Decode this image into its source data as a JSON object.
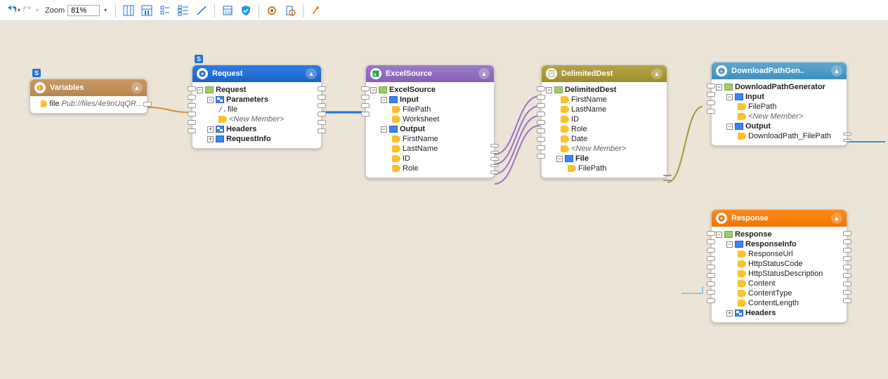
{
  "toolbar": {
    "zoom_label": "Zoom",
    "zoom_value": "81%"
  },
  "nodes": {
    "variables": {
      "title": "Variables",
      "file_label": "file",
      "file_value": "Pub://files/4e9nUqQR..."
    },
    "request": {
      "title": "Request",
      "root": "Request",
      "params": "Parameters",
      "file": "file",
      "newmember": "<New Member>",
      "headers": "Headers",
      "reqinfo": "RequestInfo"
    },
    "excel": {
      "title": "ExcelSource",
      "root": "ExcelSource",
      "input": "Input",
      "filepath": "FilePath",
      "worksheet": "Worksheet",
      "output": "Output",
      "firstname": "FirstName",
      "lastname": "LastName",
      "id": "ID",
      "role": "Role"
    },
    "delimited": {
      "title": "DelimitedDest",
      "root": "DelimitedDest",
      "firstname": "FirstName",
      "lastname": "LastName",
      "id": "ID",
      "role": "Role",
      "date": "Date",
      "newmember": "<New Member>",
      "file": "File",
      "filepath": "FilePath"
    },
    "download": {
      "title": "DownloadPathGen..",
      "root": "DownloadPathGenerator",
      "input": "Input",
      "filepath": "FilePath",
      "newmember": "<New Member>",
      "output": "Output",
      "dlpath": "DownloadPath_FilePath"
    },
    "response": {
      "title": "Response",
      "root": "Response",
      "respinfo": "ResponseInfo",
      "url": "ResponseUrl",
      "status": "HttpStatusCode",
      "statusdesc": "HttpStatusDescription",
      "content": "Content",
      "ctype": "ContentType",
      "clen": "ContentLength",
      "headers": "Headers"
    }
  }
}
